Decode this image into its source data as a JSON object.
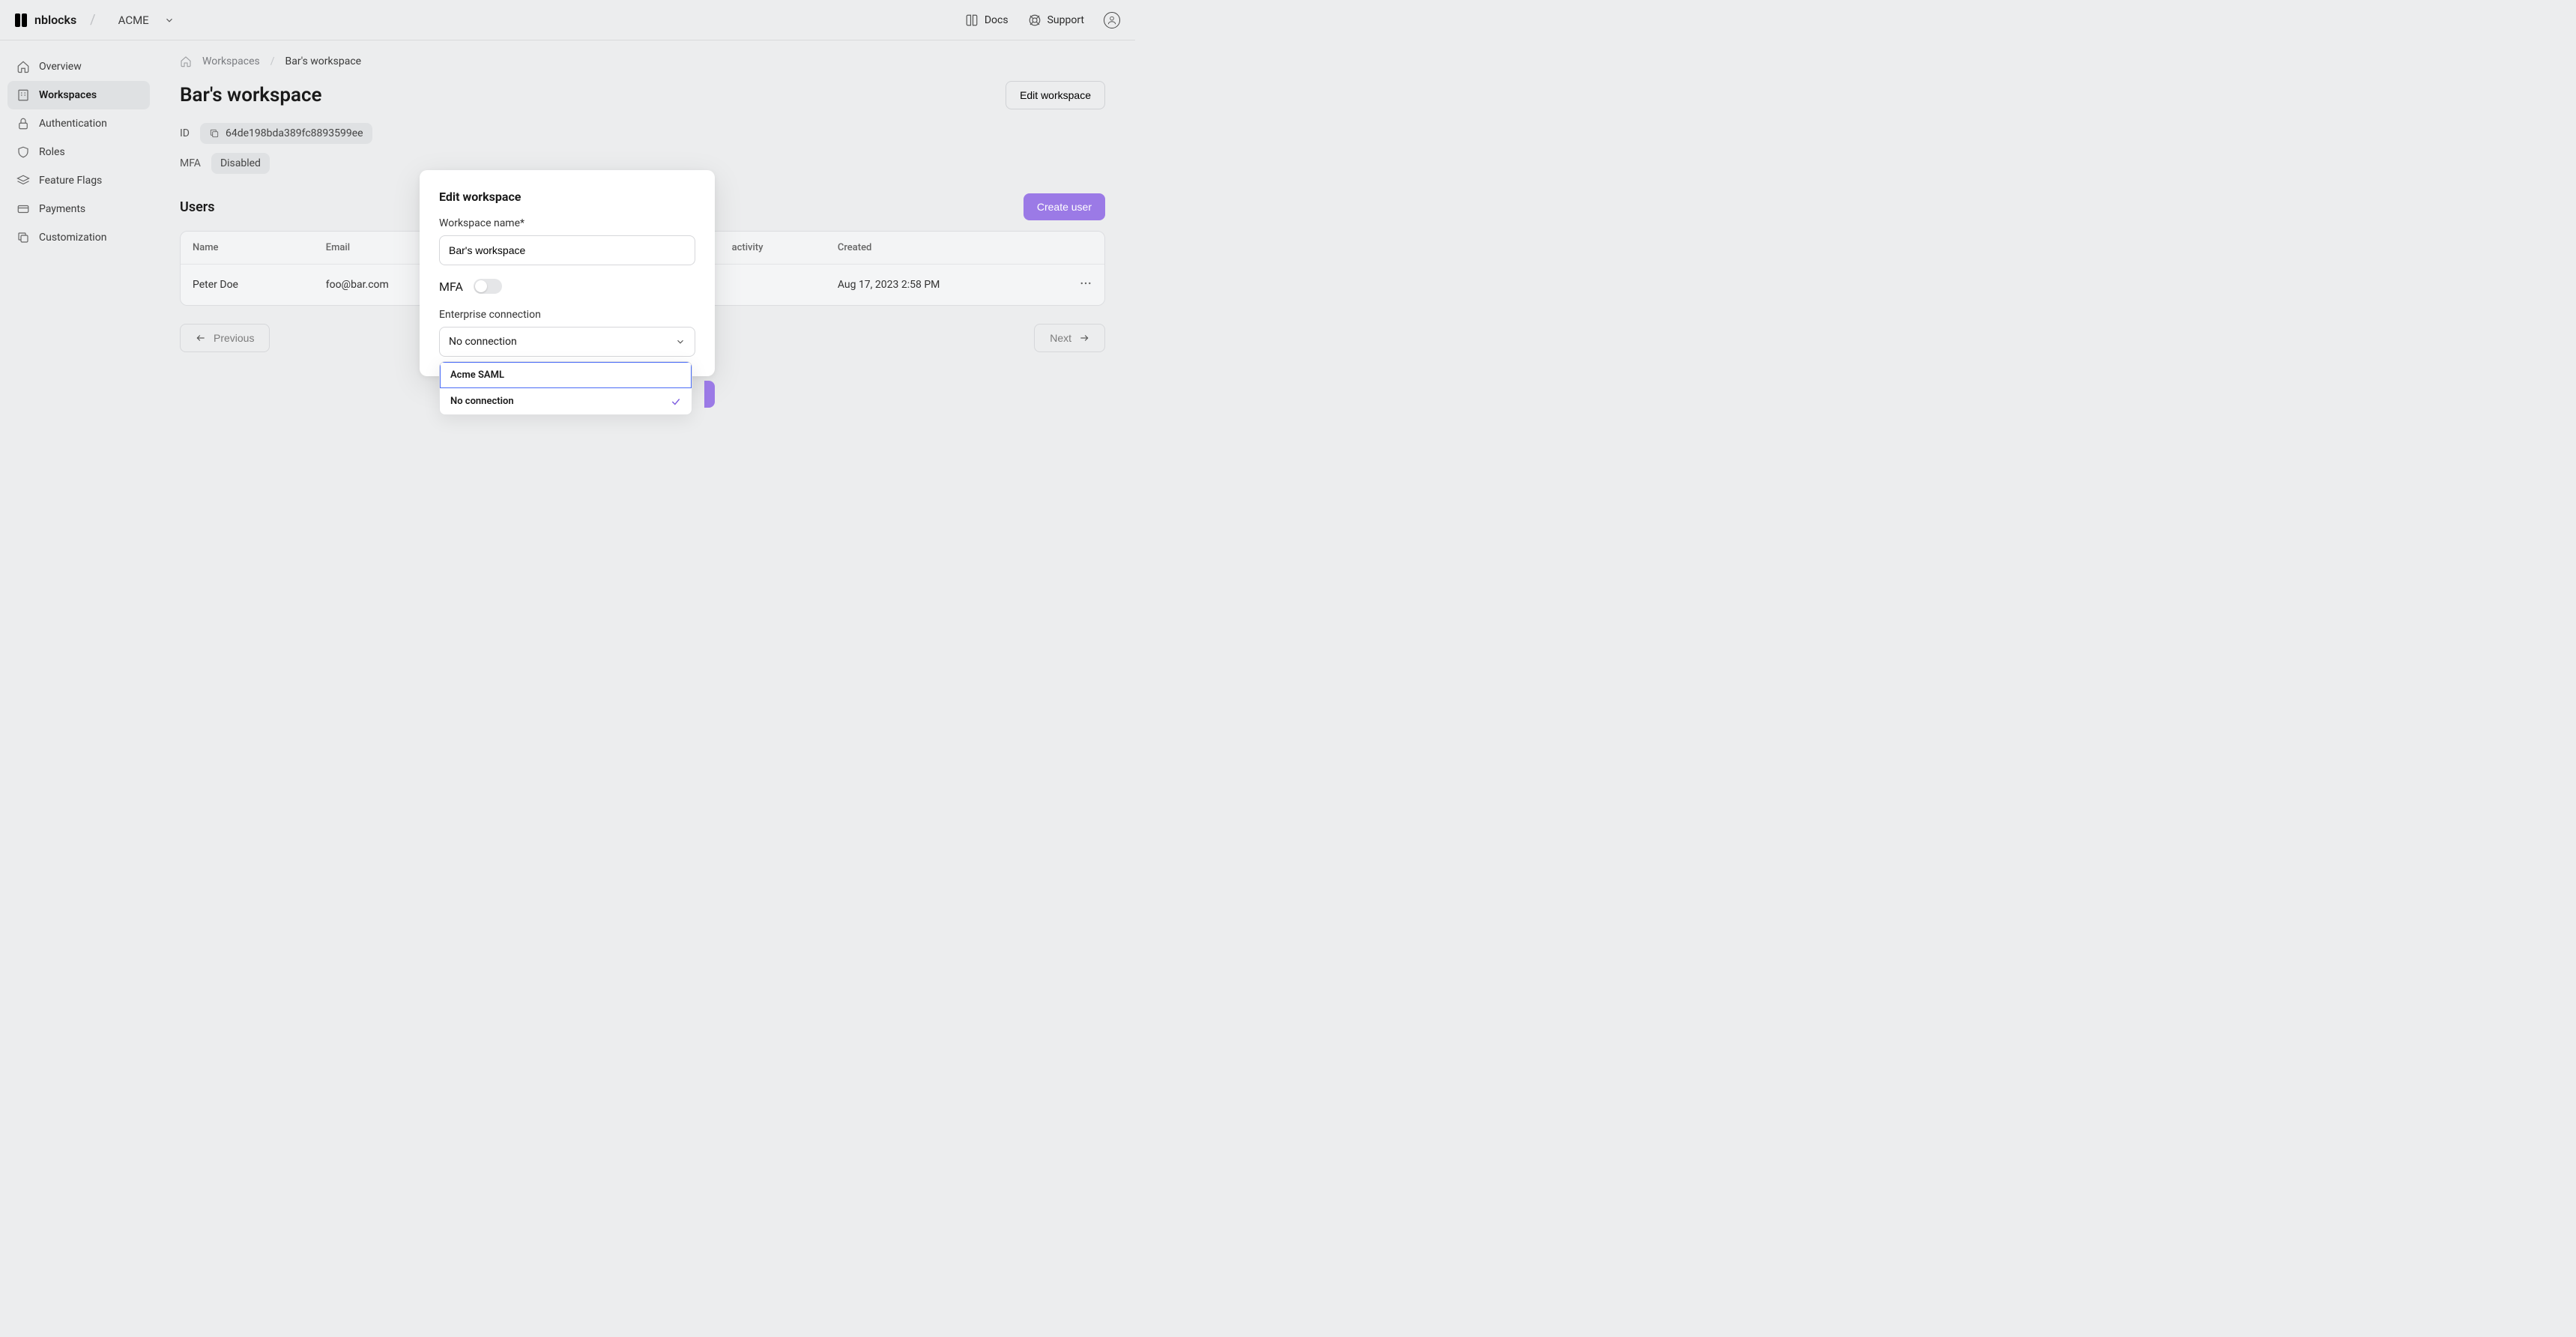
{
  "header": {
    "brand": "nblocks",
    "org": "ACME",
    "docs": "Docs",
    "support": "Support"
  },
  "sidebar": {
    "items": [
      {
        "label": "Overview"
      },
      {
        "label": "Workspaces"
      },
      {
        "label": "Authentication"
      },
      {
        "label": "Roles"
      },
      {
        "label": "Feature Flags"
      },
      {
        "label": "Payments"
      },
      {
        "label": "Customization"
      }
    ]
  },
  "crumbs": {
    "root": "Workspaces",
    "current": "Bar's workspace"
  },
  "page": {
    "title": "Bar's workspace",
    "edit_btn": "Edit workspace",
    "id_label": "ID",
    "id_value": "64de198bda389fc8893599ee",
    "mfa_label": "MFA",
    "mfa_value": "Disabled",
    "users_title": "Users",
    "create_user_btn": "Create user"
  },
  "table": {
    "cols": [
      "Name",
      "Email",
      "activity",
      "Created"
    ],
    "rows": [
      {
        "name": "Peter Doe",
        "email": "foo@bar.com",
        "activity": "",
        "created": "Aug 17, 2023 2:58 PM"
      }
    ]
  },
  "pager": {
    "prev": "Previous",
    "next": "Next"
  },
  "modal": {
    "title": "Edit workspace",
    "name_label": "Workspace name*",
    "name_value": "Bar's workspace",
    "mfa_label": "MFA",
    "conn_label": "Enterprise connection",
    "conn_selected": "No connection",
    "options": [
      {
        "label": "Acme SAML",
        "selected": false
      },
      {
        "label": "No connection",
        "selected": true
      }
    ]
  }
}
